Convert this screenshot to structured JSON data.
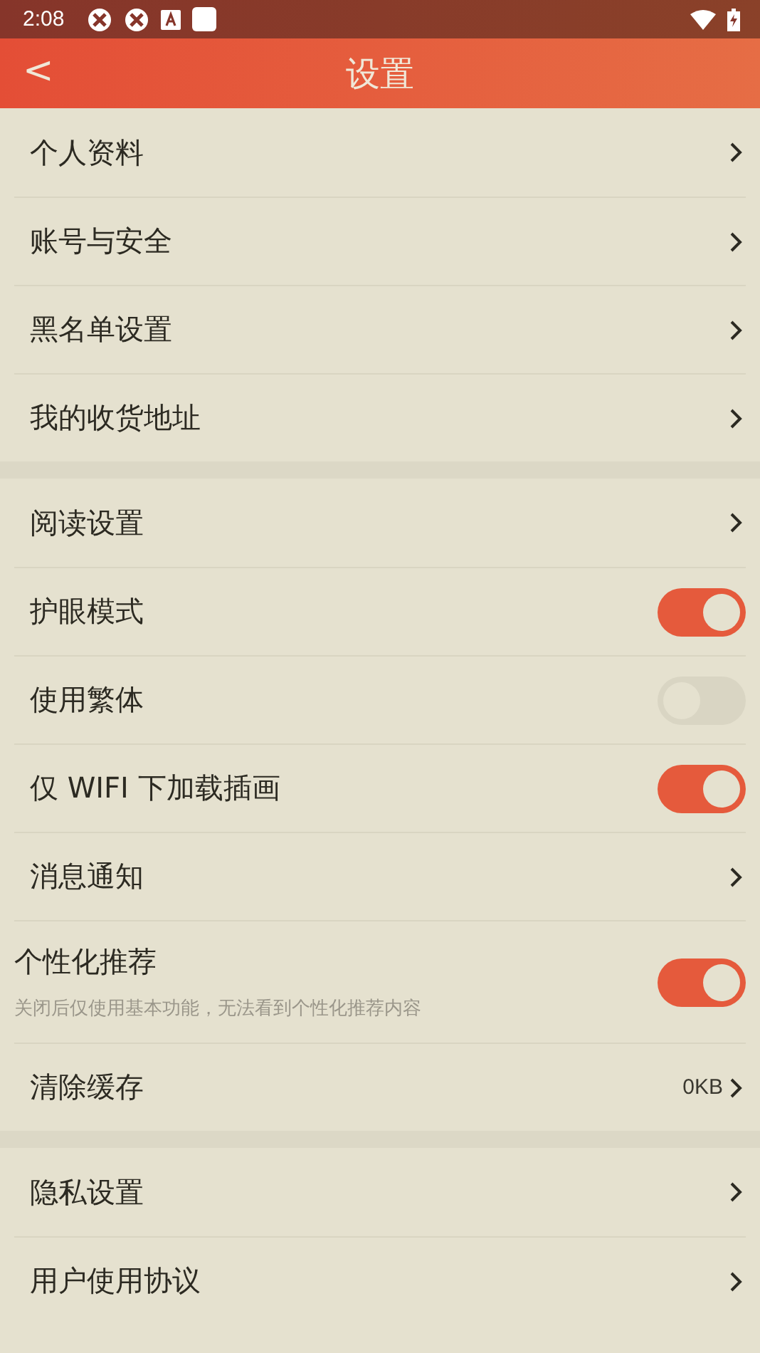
{
  "status_bar": {
    "time": "2:08"
  },
  "header": {
    "back": "<",
    "title": "设置"
  },
  "sections": [
    {
      "items": [
        {
          "kind": "link",
          "label": "个人资料"
        },
        {
          "kind": "link",
          "label": "账号与安全"
        },
        {
          "kind": "link",
          "label": "黑名单设置"
        },
        {
          "kind": "link",
          "label": "我的收货地址"
        }
      ]
    },
    {
      "items": [
        {
          "kind": "link",
          "label": "阅读设置"
        },
        {
          "kind": "toggle",
          "label": "护眼模式",
          "on": true
        },
        {
          "kind": "toggle",
          "label": "使用繁体",
          "on": false
        },
        {
          "kind": "toggle",
          "label": "仅 WIFI 下加载插画",
          "on": true
        },
        {
          "kind": "link",
          "label": "消息通知"
        },
        {
          "kind": "toggle",
          "label": "个性化推荐",
          "on": true,
          "description": "关闭后仅使用基本功能，无法看到个性化推荐内容"
        },
        {
          "kind": "value",
          "label": "清除缓存",
          "value": "0KB"
        }
      ]
    },
    {
      "items": [
        {
          "kind": "link",
          "label": "隐私设置"
        },
        {
          "kind": "link",
          "label": "用户使用协议"
        }
      ]
    }
  ]
}
